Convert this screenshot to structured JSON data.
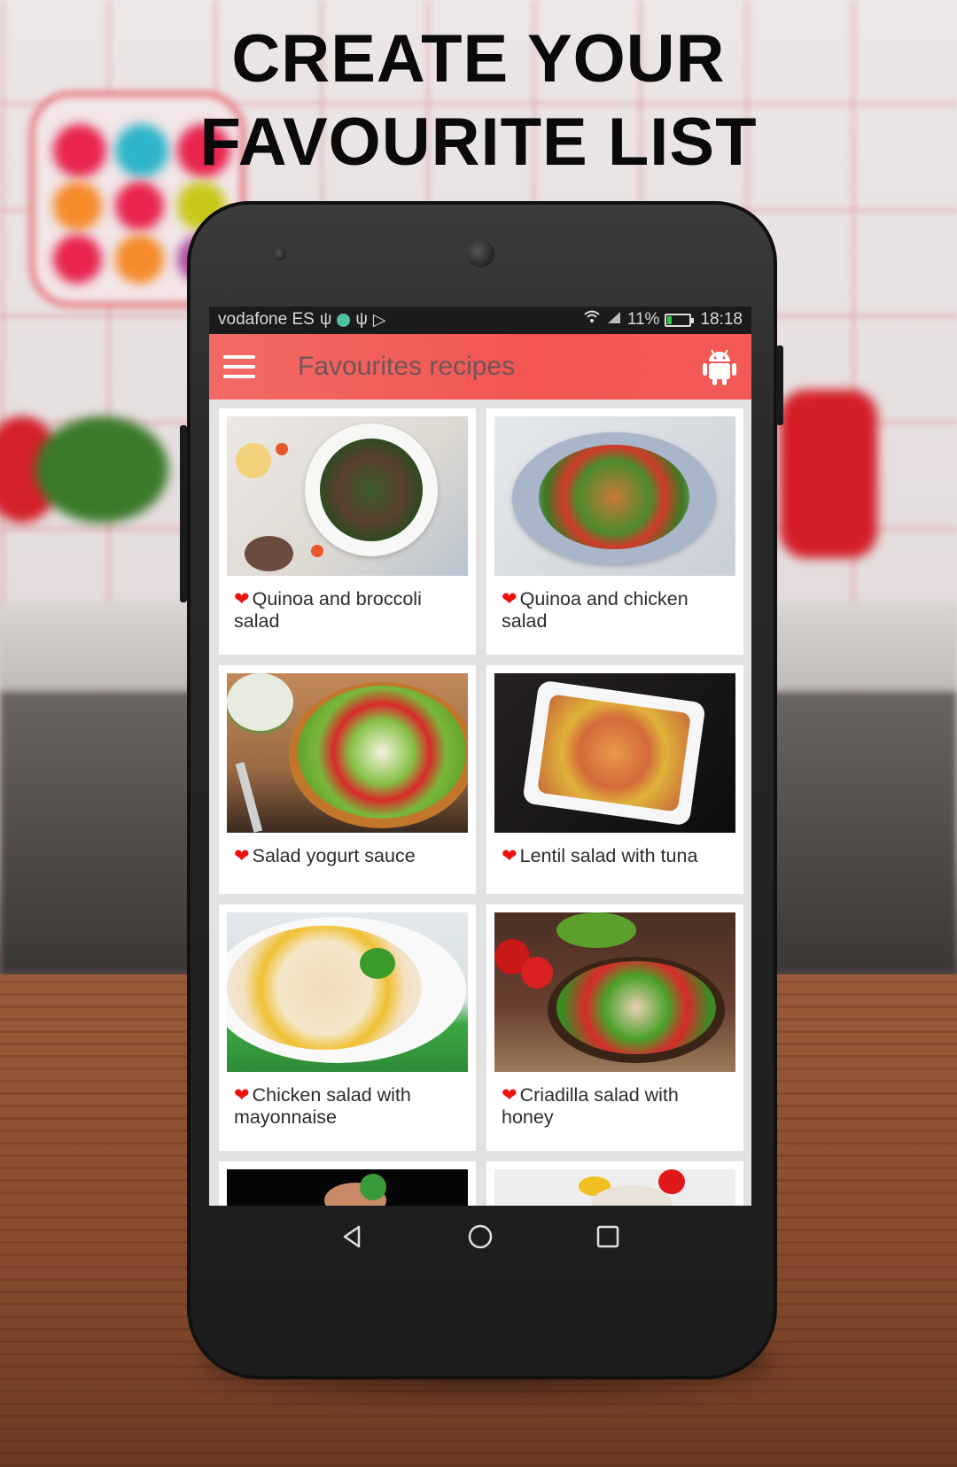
{
  "headline": {
    "line1": "CREATE YOUR",
    "line2": "FAVOURITE LIST"
  },
  "statusbar": {
    "carrier": "vodafone ES",
    "icons_left": [
      "usb-icon",
      "app-notification-icon",
      "usb-icon",
      "play-store-icon"
    ],
    "icons_right": [
      "wifi-icon",
      "signal-icon",
      "battery-icon"
    ],
    "battery": "11%",
    "time": "18:18",
    "battery_color": "#2ecc40"
  },
  "appbar": {
    "menu_icon": "hamburger-menu-icon",
    "title": "Favourites recipes",
    "action_icon": "android-icon",
    "color": "#f25552"
  },
  "favourite_icon": "❤",
  "favourite_color": "#ee1111",
  "recipes": [
    {
      "title": "Quinoa and broccoli salad",
      "image": "quinoa-broccoli-salad-photo"
    },
    {
      "title": "Quinoa and chicken salad",
      "image": "quinoa-chicken-salad-photo"
    },
    {
      "title": "Salad yogurt sauce",
      "image": "salad-yogurt-sauce-photo"
    },
    {
      "title": "Lentil salad with tuna",
      "image": "lentil-salad-tuna-photo"
    },
    {
      "title": "Chicken salad with mayonnaise",
      "image": "chicken-salad-mayonnaise-photo"
    },
    {
      "title": "Criadilla salad with honey",
      "image": "criadilla-salad-honey-photo"
    },
    {
      "title": "",
      "image": "partial-recipe-photo"
    },
    {
      "title": "",
      "image": "partial-recipe-photo"
    }
  ],
  "navbar": {
    "back": "back-icon",
    "home": "home-icon",
    "recents": "recents-icon"
  }
}
